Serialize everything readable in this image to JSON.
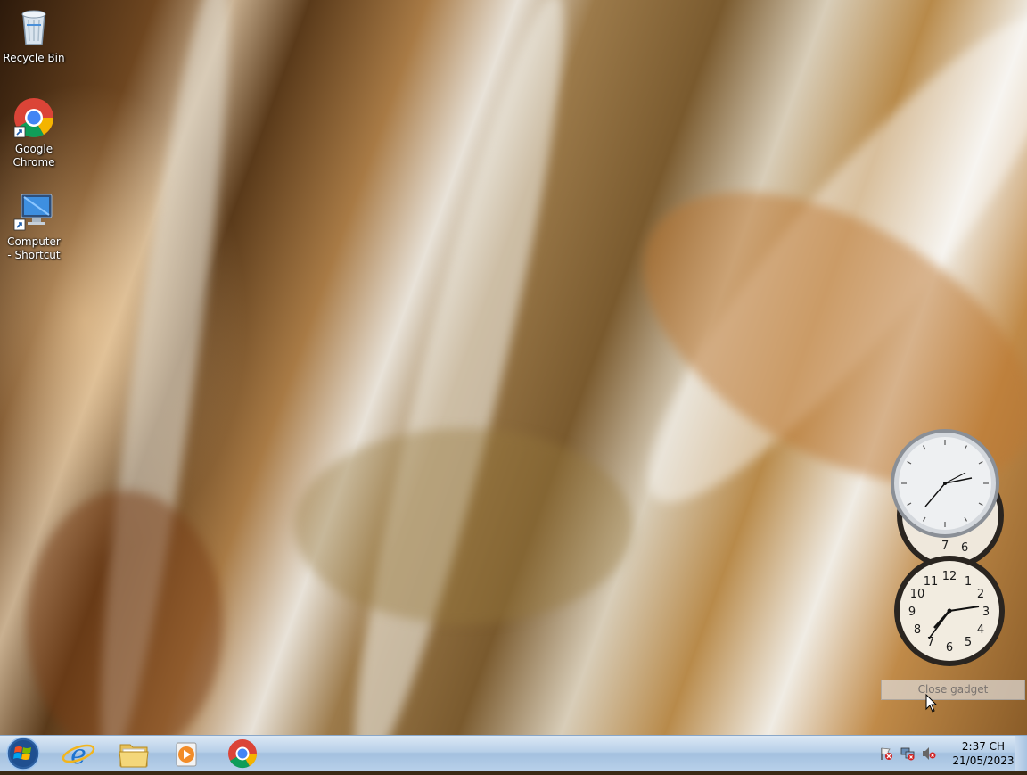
{
  "desktop": {
    "icons": [
      {
        "label": "Recycle Bin",
        "icon": "recycle-bin-icon"
      },
      {
        "label": "Google Chrome",
        "icon": "chrome-icon"
      },
      {
        "label": "Computer - Shortcut",
        "icon": "computer-icon"
      }
    ]
  },
  "gadgets": {
    "clock_top": {
      "icon": "analog-clock-icon",
      "numbers": [
        "6",
        "7"
      ]
    },
    "clock_bottom": {
      "icon": "analog-clock-icon",
      "numbers": [
        "12",
        "1",
        "2",
        "3",
        "4",
        "5",
        "6",
        "7",
        "8",
        "9",
        "10",
        "11"
      ]
    },
    "tooltip": "Close gadget"
  },
  "taskbar": {
    "start": {
      "icon": "windows-start-icon"
    },
    "pinned": [
      {
        "name": "Internet Explorer",
        "icon": "internet-explorer-icon"
      },
      {
        "name": "Windows Explorer",
        "icon": "folder-icon"
      },
      {
        "name": "Windows Media Player",
        "icon": "media-player-icon"
      },
      {
        "name": "Google Chrome",
        "icon": "chrome-icon"
      }
    ],
    "tray": {
      "icons": [
        "action-center-flag-icon",
        "network-icon",
        "volume-muted-icon"
      ],
      "time": "2:37 CH",
      "date": "21/05/2023"
    }
  },
  "colors": {
    "taskbar": "#b7cfe8",
    "accent": "#3a6ea5"
  }
}
